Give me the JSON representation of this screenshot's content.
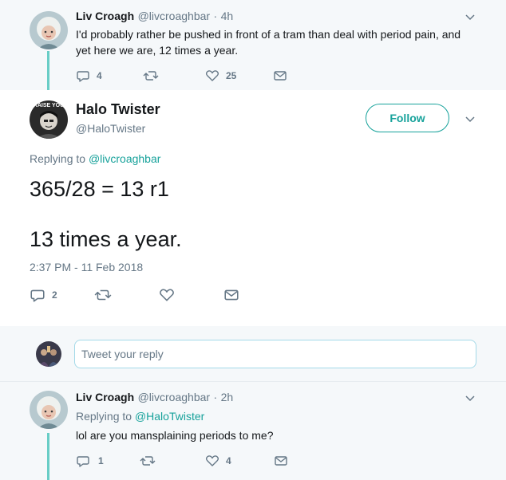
{
  "parent_tweet": {
    "name": "Liv Croagh",
    "handle": "@livcroaghbar",
    "separator": "·",
    "time": "4h",
    "text": "I'd probably rather be pushed in front of a tram than deal with period pain, and yet here we are, 12 times a year.",
    "replies": "4",
    "retweets": "",
    "likes": "25"
  },
  "main_tweet": {
    "name": "Halo Twister",
    "handle": "@HaloTwister",
    "follow_label": "Follow",
    "replying_prefix": "Replying to",
    "replying_to": "@livcroaghbar",
    "text_line1": "365/28 = 13 r1",
    "text_line2": "13 times a year.",
    "timestamp": "2:37 PM - 11 Feb 2018",
    "replies": "2",
    "avatar_text": "RAISE YOU"
  },
  "reply_composer": {
    "placeholder": "Tweet your reply"
  },
  "child_tweet": {
    "name": "Liv Croagh",
    "handle": "@livcroaghbar",
    "separator": "·",
    "time": "2h",
    "replying_prefix": "Replying to",
    "replying_to": "@HaloTwister",
    "text": "lol are you mansplaining periods to me?",
    "replies": "1",
    "likes": "4"
  },
  "colors": {
    "accent": "#17a29b",
    "thread_line": "#68cdc6",
    "muted": "#657786",
    "background_gray": "#f5f8fa"
  }
}
